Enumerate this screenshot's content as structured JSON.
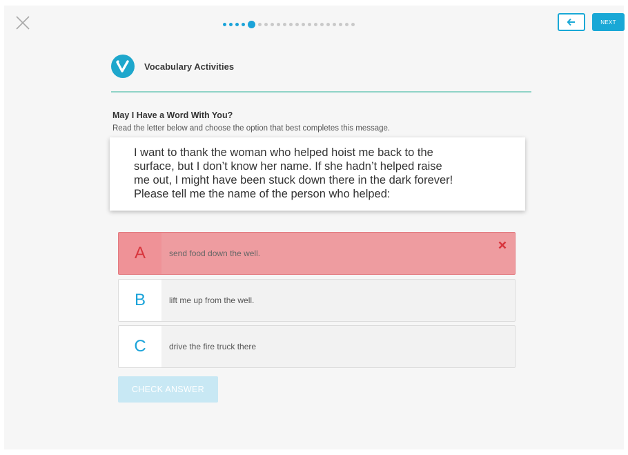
{
  "window": {
    "close_icon": "close-x-icon"
  },
  "progress": {
    "current_step": 5,
    "total_steps": 21
  },
  "nav": {
    "back_icon": "arrow-left-icon",
    "next_label": "NEXT"
  },
  "activity": {
    "logo_icon": "vocabulary-v-logo",
    "title": "Vocabulary Activities"
  },
  "question": {
    "title": "May I Have a Word With You?",
    "instruction": "Read the letter below and choose the option that best completes this message.",
    "letter_lines": [
      "I want to thank the woman who helped hoist me back to the",
      "surface, but I don’t know her name. If she hadn’t helped raise",
      "me out, I might have been stuck down there in the dark forever!",
      "Please tell me the name of the person who helped:"
    ]
  },
  "options": [
    {
      "letter": "A",
      "text": "send food down the well.",
      "state": "incorrect"
    },
    {
      "letter": "B",
      "text": "lift me up from the well.",
      "state": "default"
    },
    {
      "letter": "C",
      "text": "drive the fire truck there",
      "state": "default"
    }
  ],
  "actions": {
    "check_answer_label": "CHECK ANSWER",
    "check_answer_enabled": false
  },
  "colors": {
    "accent": "#1aa3d9",
    "incorrect": "#ee9ca0",
    "divider": "#8fd3c7"
  }
}
